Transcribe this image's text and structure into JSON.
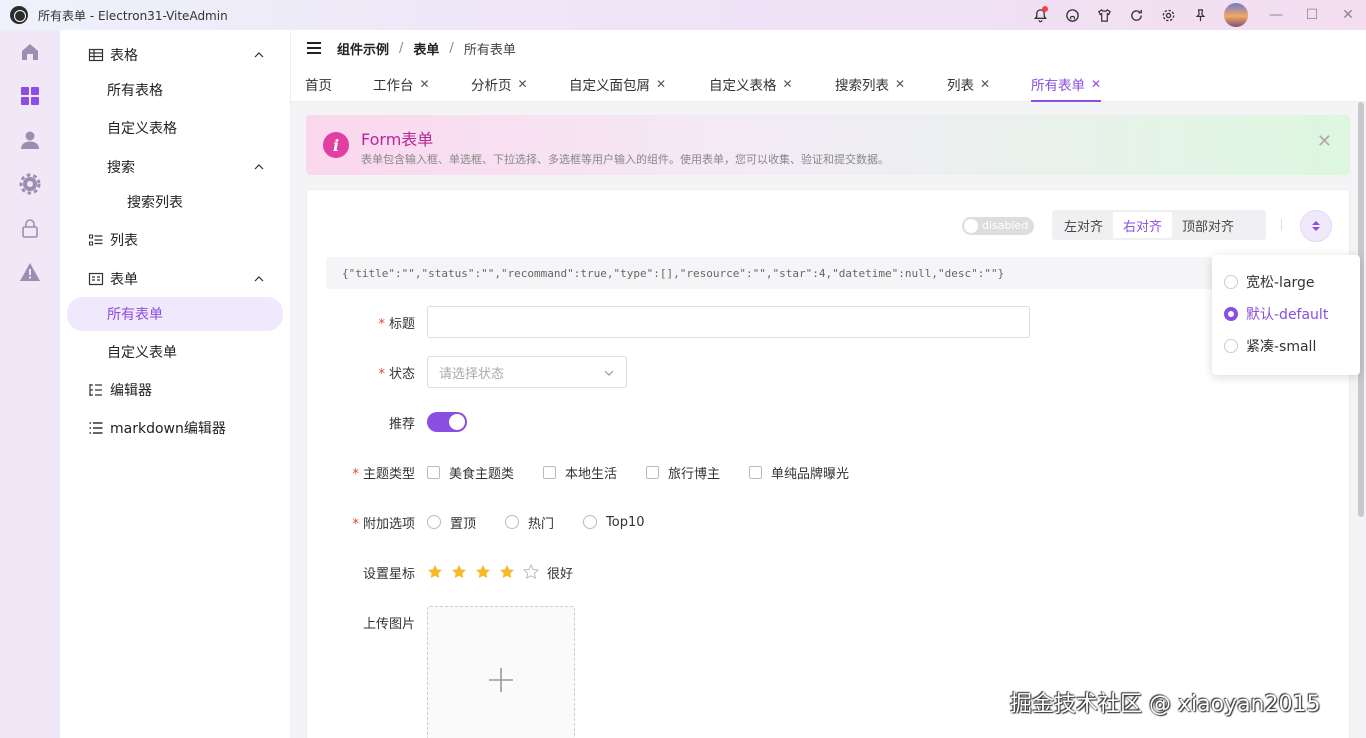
{
  "window": {
    "title": "所有表单 - Electron31-ViteAdmin",
    "controls": [
      "minimize",
      "maximize",
      "close"
    ]
  },
  "toolbar_icons": [
    "bell-icon",
    "github-icon",
    "shirt-icon",
    "refresh-icon",
    "settings-icon",
    "pin-icon"
  ],
  "iconbar": [
    "home-icon",
    "dashboard-icon",
    "user-icon",
    "gear-icon",
    "lock-icon",
    "warning-icon"
  ],
  "menu": {
    "items": [
      {
        "label": "表格",
        "icon": "table-icon",
        "expanded": true
      },
      {
        "label": "所有表格"
      },
      {
        "label": "自定义表格"
      },
      {
        "label": "搜索",
        "expanded": true
      },
      {
        "label": "搜索列表"
      },
      {
        "label": "列表",
        "icon": "list-icon"
      },
      {
        "label": "表单",
        "icon": "form-icon",
        "expanded": true
      },
      {
        "label": "所有表单",
        "active": true
      },
      {
        "label": "自定义表单"
      },
      {
        "label": "编辑器",
        "icon": "editor-icon"
      },
      {
        "label": "markdown编辑器",
        "icon": "list-icon"
      }
    ]
  },
  "breadcrumb": [
    "组件示例",
    "表单",
    "所有表单"
  ],
  "breadcrumb_sep": "/",
  "tabs": [
    {
      "label": "首页",
      "closable": false
    },
    {
      "label": "工作台",
      "closable": true
    },
    {
      "label": "分析页",
      "closable": true
    },
    {
      "label": "自定义面包屑",
      "closable": true
    },
    {
      "label": "自定义表格",
      "closable": true
    },
    {
      "label": "搜索列表",
      "closable": true
    },
    {
      "label": "列表",
      "closable": true
    },
    {
      "label": "所有表单",
      "closable": true,
      "active": true
    }
  ],
  "tab_close": "✕",
  "alert": {
    "title": "Form表单",
    "desc": "表单包含输入框、单选框、下拉选择、多选框等用户输入的组件。使用表单，您可以收集、验证和提交数据。",
    "icon": "i",
    "close": "✕"
  },
  "form_toolbar": {
    "disabled_switch": "disabled",
    "align_options": [
      "左对齐",
      "右对齐",
      "顶部对齐"
    ],
    "align_selected": "右对齐"
  },
  "json_preview": "{\"title\":\"\",\"status\":\"\",\"recommand\":true,\"type\":[],\"resource\":\"\",\"star\":4,\"datetime\":null,\"desc\":\"\"}",
  "form": {
    "title_label": "标题",
    "title_value": "",
    "status_label": "状态",
    "status_placeholder": "请选择状态",
    "recommend_label": "推荐",
    "recommend_on": true,
    "type_label": "主题类型",
    "type_options": [
      "美食主题类",
      "本地生活",
      "旅行博主",
      "单纯品牌曝光"
    ],
    "extra_label": "附加选项",
    "extra_options": [
      "置顶",
      "热门",
      "Top10"
    ],
    "star_label": "设置星标",
    "star_value": 4,
    "star_max": 5,
    "star_text": "很好",
    "upload_label": "上传图片",
    "upload_icon": "+"
  },
  "size_dropdown": {
    "options": [
      "宽松-large",
      "默认-default",
      "紧凑-small"
    ],
    "selected": "默认-default"
  },
  "watermark": "掘金技术社区 @ xiaoyan2015",
  "colors": {
    "accent": "#8a4fe0",
    "alert_accent": "#e23fa3",
    "required": "#e23f3f",
    "star": "#f7ba2a"
  }
}
